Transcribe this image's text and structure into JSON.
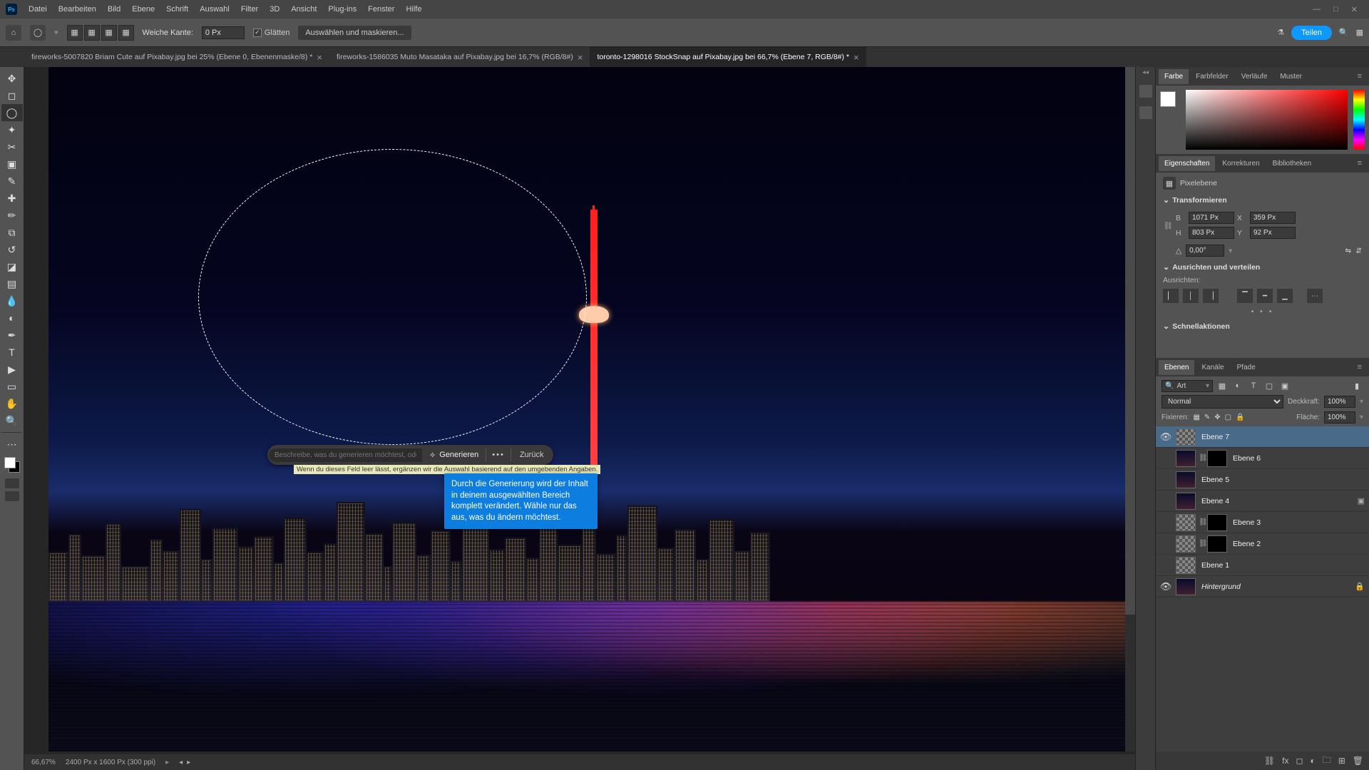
{
  "menubar": [
    "Datei",
    "Bearbeiten",
    "Bild",
    "Ebene",
    "Schrift",
    "Auswahl",
    "Filter",
    "3D",
    "Ansicht",
    "Plug-ins",
    "Fenster",
    "Hilfe"
  ],
  "optbar": {
    "weiche_kante_label": "Weiche Kante:",
    "weiche_kante_value": "0 Px",
    "glaetten_label": "Glätten",
    "auswaehlen_label": "Auswählen und maskieren...",
    "share_label": "Teilen"
  },
  "tabs": [
    {
      "label": "fireworks-5007820 Briam Cute auf Pixabay.jpg bei 25% (Ebene 0, Ebenenmaske/8) *",
      "active": false
    },
    {
      "label": "fireworks-1586035 Muto Masataka auf Pixabay.jpg bei 16,7% (RGB/8#)",
      "active": false
    },
    {
      "label": "toronto-1298016 StockSnap auf Pixabay.jpg bei 66,7% (Ebene 7, RGB/8#) *",
      "active": true
    }
  ],
  "ctx": {
    "placeholder": "Beschreibe, was du generieren möchtest, oder gib einfach gar nichts an (nur Englisch)",
    "generate_label": "Generieren",
    "back_label": "Zurück",
    "hint": "Wenn du dieses Feld leer lässt, ergänzen wir die Auswahl basierend auf den umgebenden Angaben.",
    "tooltip": "Durch die Generierung wird der Inhalt in deinem ausgewählten Bereich komplett verändert. Wähle nur das aus, was du ändern möchtest."
  },
  "status": {
    "zoom": "66,67%",
    "docinfo": "2400 Px x 1600 Px (300 ppi)"
  },
  "panel_color_tabs": [
    "Farbe",
    "Farbfelder",
    "Verläufe",
    "Muster"
  ],
  "panel_props_tabs": [
    "Eigenschaften",
    "Korrekturen",
    "Bibliotheken"
  ],
  "panel_layers_tabs": [
    "Ebenen",
    "Kanäle",
    "Pfade"
  ],
  "props": {
    "type_label": "Pixelebene",
    "sec_transform": "Transformieren",
    "B_label": "B",
    "B_value": "1071 Px",
    "X_label": "X",
    "X_value": "359 Px",
    "H_label": "H",
    "H_value": "803 Px",
    "Y_label": "Y",
    "Y_value": "92 Px",
    "angle_value": "0,00°",
    "sec_align": "Ausrichten und verteilen",
    "align_label": "Ausrichten:",
    "sec_quick": "Schnellaktionen"
  },
  "layers_ctrl": {
    "search_kind": "Art",
    "blend": "Normal",
    "opacity_label": "Deckkraft:",
    "opacity": "100%",
    "lock_label": "Fixieren:",
    "fill_label": "Fläche:",
    "fill": "100%"
  },
  "layers": [
    {
      "name": "Ebene 7",
      "vis": true,
      "sel": true,
      "mask": false,
      "thumb": "chk"
    },
    {
      "name": "Ebene 6",
      "vis": false,
      "sel": false,
      "mask": true,
      "thumb": "img"
    },
    {
      "name": "Ebene 5",
      "vis": false,
      "sel": false,
      "mask": false,
      "thumb": "img"
    },
    {
      "name": "Ebene 4",
      "vis": false,
      "sel": false,
      "mask": false,
      "thumb": "img",
      "smart": true
    },
    {
      "name": "Ebene 3",
      "vis": false,
      "sel": false,
      "mask": true,
      "thumb": "chk"
    },
    {
      "name": "Ebene 2",
      "vis": false,
      "sel": false,
      "mask": true,
      "thumb": "chk"
    },
    {
      "name": "Ebene 1",
      "vis": false,
      "sel": false,
      "mask": false,
      "thumb": "chk"
    },
    {
      "name": "Hintergrund",
      "vis": true,
      "sel": false,
      "mask": false,
      "thumb": "img",
      "locked": true,
      "italic": true
    }
  ]
}
